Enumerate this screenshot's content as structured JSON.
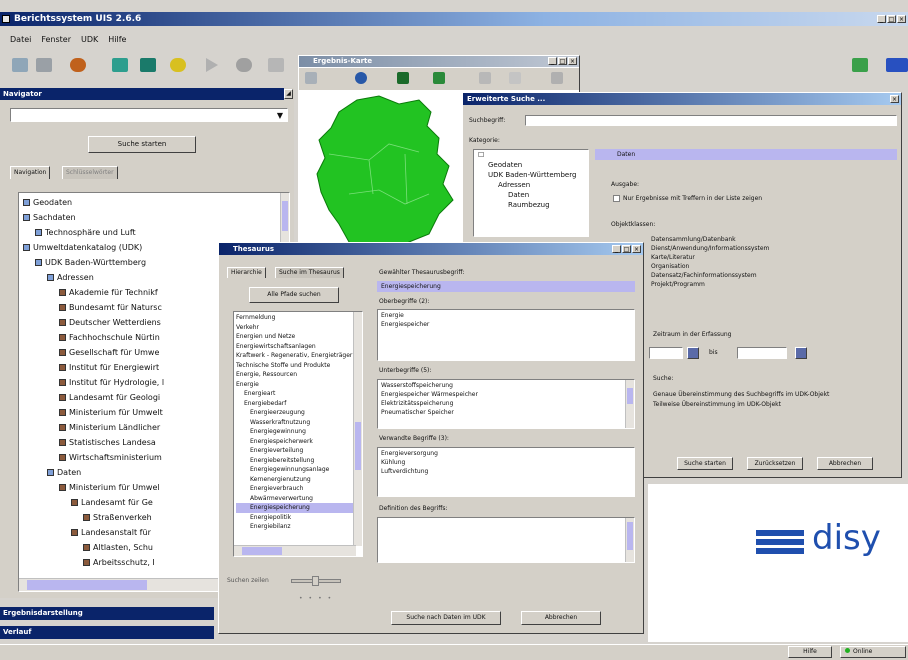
{
  "main": {
    "title": "Berichtssystem UIS 2.6.6",
    "menu": [
      "Datei",
      "Fenster",
      "UDK",
      "Hilfe"
    ]
  },
  "navigator": {
    "title": "Navigator",
    "search_button": "Suche starten",
    "tabs": [
      "Navigation",
      "Schlüsselwörter"
    ],
    "tree": [
      {
        "label": "Geodaten",
        "indent": 0
      },
      {
        "label": "Sachdaten",
        "indent": 0
      },
      {
        "label": "Technosphäre und Luft",
        "indent": 1
      },
      {
        "label": "Umweltdatenkatalog (UDK)",
        "indent": 0
      },
      {
        "label": "UDK Baden-Württemberg",
        "indent": 1
      },
      {
        "label": "Adressen",
        "indent": 2
      },
      {
        "label": "Akademie für Technikf",
        "indent": 3
      },
      {
        "label": "Bundesamt für Natursc",
        "indent": 3
      },
      {
        "label": "Deutscher Wetterdiens",
        "indent": 3
      },
      {
        "label": "Fachhochschule Nürtin",
        "indent": 3
      },
      {
        "label": "Gesellschaft für Umwe",
        "indent": 3
      },
      {
        "label": "Institut für Energiewirt",
        "indent": 3
      },
      {
        "label": "Institut für Hydrologie, l",
        "indent": 3
      },
      {
        "label": "Landesamt für Geologi",
        "indent": 3
      },
      {
        "label": "Ministerium für Umwelt",
        "indent": 3
      },
      {
        "label": "Ministerium Ländlicher",
        "indent": 3
      },
      {
        "label": "Statistisches Landesa",
        "indent": 3
      },
      {
        "label": "Wirtschaftsministerium",
        "indent": 3
      },
      {
        "label": "Daten",
        "indent": 2
      },
      {
        "label": "Ministerium für Umwel",
        "indent": 3
      },
      {
        "label": "Landesamt für Ge",
        "indent": 4
      },
      {
        "label": "Straßenverkeh",
        "indent": 5
      },
      {
        "label": "Landesanstalt für",
        "indent": 4
      },
      {
        "label": "Altlasten, Schu",
        "indent": 5
      },
      {
        "label": "Arbeitsschutz, I",
        "indent": 5
      }
    ],
    "bottom_bars": [
      "Ergebnisdarstellung",
      "Verlauf"
    ]
  },
  "map_window": {
    "title": "Ergebnis-Karte"
  },
  "search_window": {
    "title": "Erweiterte Suche ...",
    "suchbegriff_label": "Suchbegriff:",
    "kategorie_label": "Kategorie:",
    "tree": [
      "Geodaten",
      "UDK Baden-Württemberg",
      "Adressen",
      "Daten",
      "Raumbezug"
    ],
    "selected_category": "Daten",
    "ausgabe_label": "Ausgabe:",
    "ausgabe_option": "Nur Ergebnisse mit Treffern in der Liste zeigen",
    "objektklassen_label": "Objektklassen:",
    "objektklassen": [
      "Datensammlung/Datenbank",
      "Dienst/Anwendung/Informationssystem",
      "Karte/Literatur",
      "Organisation",
      "Datensatz/Fachinformationssystem",
      "Projekt/Programm"
    ],
    "zeitraum_label": "Zeitraum in der Erfassung",
    "bis_label": "bis",
    "suche_label": "Suche:",
    "suche_options": [
      "Genaue Übereinstimmung des Suchbegriffs im UDK-Objekt",
      "Teilweise Übereinstimmung im UDK-Objekt"
    ],
    "buttons": [
      "Suche starten",
      "Zurücksetzen",
      "Abbrechen"
    ]
  },
  "thesaurus_window": {
    "title": "Thesaurus",
    "tabs": [
      "Hierarchie",
      "Suche im Thesaurus"
    ],
    "alle_pfade_button": "Alle Pfade suchen",
    "hierarchy": [
      "Fernmeldung",
      "Verkehr",
      "Energien und Netze",
      "Energiewirtschaftsanlagen",
      "Kraftwerk - Regenerativ, Energieträger",
      "Technische Stoffe und Produkte",
      "Energie, Ressourcen",
      "Energie",
      "Energieart",
      "Energiebedarf",
      "Energieerzeugung",
      "Wasserkraftnutzung",
      "Energiegewinnung",
      "Energiespeicherwerk",
      "Energieverteilung",
      "Energiebereitstellung",
      "Energiegewinnungsanlage",
      "Kernenergienutzung",
      "Energieverbrauch",
      "Abwärmeverwertung",
      "Energiespeicherung",
      "Energiepolitik",
      "Energiebilanz"
    ],
    "selected_hierarchy": "Energiespeicherung",
    "suchen_label": "Suchen zeilen",
    "gewaehlter_label": "Gewählter Thesaurusbegriff:",
    "gewaehlter_value": "Energiespeicherung",
    "oberbegriffe_label": "Oberbegriffe (2):",
    "oberbegriffe": [
      "Energie",
      "Energiespeicher"
    ],
    "unterbegriffe_label": "Unterbegriffe (5):",
    "unterbegriffe": [
      "Wasserstoffspeicherung",
      "Energiespeicher Wärmespeicher",
      "Elektrizitätsspeicherung",
      "Pneumatischer Speicher"
    ],
    "verwandte_label": "Verwandte Begriffe (3):",
    "verwandte": [
      "Energieversorgung",
      "Kühlung",
      "Luftverdichtung"
    ],
    "definition_label": "Definition des Begriffs:",
    "buttons": [
      "Suche nach Daten im UDK",
      "Abbrechen"
    ]
  },
  "logo": {
    "text": "disy"
  },
  "statusbar": {
    "items": [
      "Hilfe",
      "Online"
    ]
  },
  "colors": {
    "title_active": "#0a246a",
    "title_grad": "#a6caf0",
    "map_green": "#22c322",
    "selection": "#b9b6ef",
    "logo_blue": "#1f4fae"
  }
}
